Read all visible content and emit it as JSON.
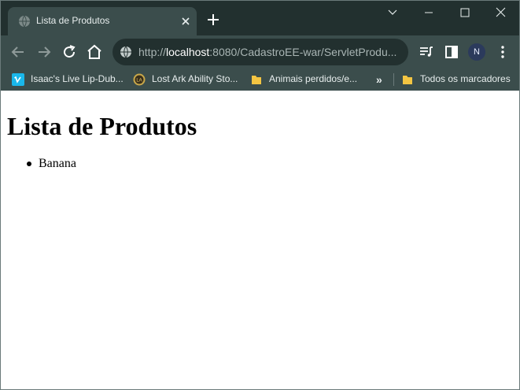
{
  "browser": {
    "tab": {
      "title": "Lista de Produtos"
    },
    "url": {
      "scheme": "http://",
      "host": "localhost",
      "rest": ":8080/CadastroEE-war/ServletProdu..."
    },
    "profile_initial": "N",
    "bookmarks": [
      {
        "label": "Isaac's Live Lip-Dub...",
        "icon": "vimeo-icon"
      },
      {
        "label": "Lost Ark Ability Sto...",
        "icon": "lost-ark-icon"
      },
      {
        "label": "Animais perdidos/e...",
        "icon": "folder-icon"
      }
    ],
    "bookmarks_more": "»",
    "all_bookmarks": "Todos os marcadores"
  },
  "page": {
    "heading": "Lista de Produtos",
    "products": [
      "Banana"
    ]
  },
  "colors": {
    "frame": "#22302f",
    "toolbar": "#3b4d4c",
    "vimeo": "#1ab7ea",
    "folder": "#f4c542"
  }
}
